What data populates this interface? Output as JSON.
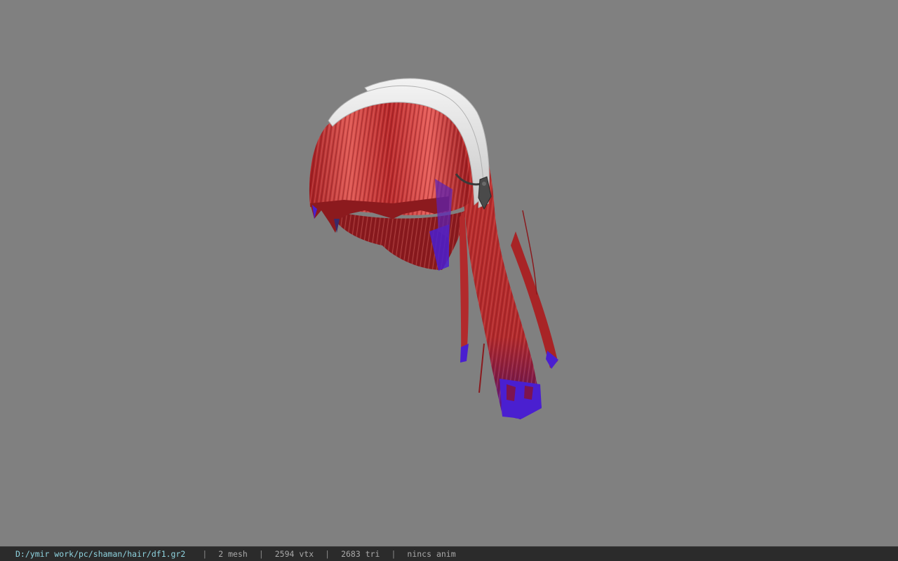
{
  "viewer": {
    "background_color": "#808080",
    "model": {
      "icon": "hair-model",
      "hair_color": "#d23a3a",
      "tip_color": "#4a1fd0",
      "band_color": "#e6e6e6",
      "clip_color": "#3a3a3a"
    }
  },
  "status": {
    "file_path": "D:/ymir work/pc/shaman/hair/df1.gr2",
    "separator": "|",
    "mesh": "2 mesh",
    "vertices": "2594 vtx",
    "triangles": "2683 tri",
    "anim": "nincs anim"
  }
}
